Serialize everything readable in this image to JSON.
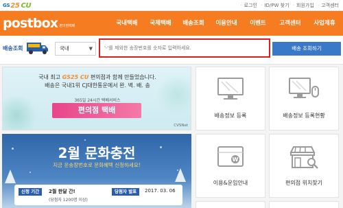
{
  "topbar": {
    "logo": {
      "gs": "GS",
      "n25": "25",
      "cu": "CU"
    },
    "links": [
      "로그인",
      "ID/PW 찾기",
      "회원가입",
      "고객센터"
    ]
  },
  "nav": {
    "brand": "postbox",
    "brand_sub": "편의점택배",
    "menu": [
      "국내택배",
      "국제택배",
      "배송조회",
      "이용안내",
      "이벤트",
      "고객센터",
      "사업제휴"
    ]
  },
  "search": {
    "title": "배송조회",
    "truck_icon": "delivery-truck-icon",
    "carrier_value": "국내",
    "invoice_placeholder": "'-'를 제외한 송장번호를 숫자로 입력하세요.",
    "button_label": "배송 조회하기"
  },
  "banner1": {
    "line1_prefix": "국내 최고",
    "line1_brand": "GS25 CU",
    "line1_suffix": "편의점과 함께 만들었습니다.",
    "line2": "배송은 국내1위 CJ대한통운에서 완. 벽. 배. 송",
    "small": "365일 24시간 택배서비스",
    "ribbon": "편의점 택배",
    "credit": "CVSNet"
  },
  "banner2": {
    "title": "2월 문화충전",
    "sub": "지금 운송장번호로 문화혜택 신청하세요!",
    "period_badge": "신청 기간",
    "period_text": "2월 한달 간!",
    "period_small": "(당첨자 1200명 이상)",
    "winner_badge": "당첨자 발표",
    "winner_date": "2017. 03. 06"
  },
  "tiles": [
    {
      "label": "배송정보 등록",
      "icon": "monitor-icon"
    },
    {
      "label": "배송정보 등록현황",
      "icon": "computer-mouse-icon"
    },
    {
      "label": "이용&운임안내",
      "icon": "wallet-icon"
    },
    {
      "label": "편의점 위치찾기",
      "icon": "store-search-icon"
    }
  ],
  "colors": {
    "brand": "#f57c20",
    "accent_blue": "#3a79c8",
    "highlight_red": "#e21b1b"
  }
}
